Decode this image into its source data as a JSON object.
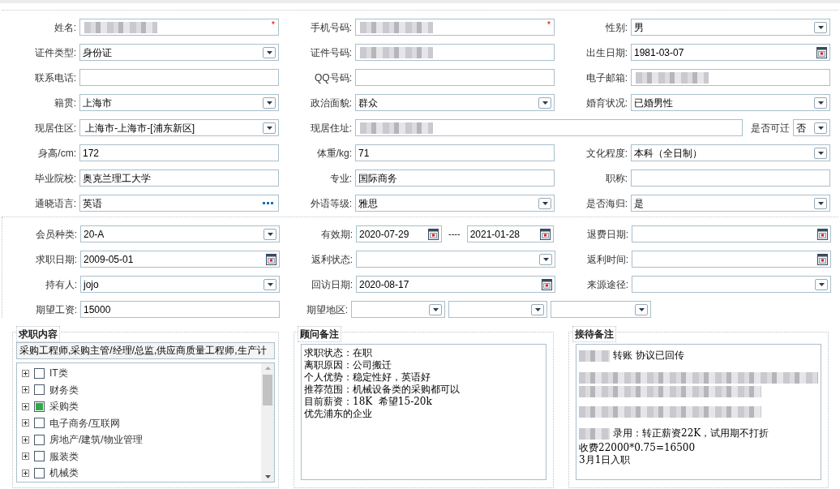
{
  "sections": [
    {
      "rows": [
        {
          "cells": [
            {
              "label": "姓名:",
              "kind": "text",
              "redacted": true,
              "required_mark": "*"
            },
            {
              "label": "手机号码:",
              "kind": "text",
              "redacted": true,
              "required_mark": "*"
            },
            {
              "label": "性别:",
              "kind": "select",
              "value": "男"
            }
          ]
        },
        {
          "cells": [
            {
              "label": "证件类型:",
              "kind": "select",
              "value": "身份证"
            },
            {
              "label": "证件号码:",
              "kind": "text",
              "redacted": true
            },
            {
              "label": "出生日期:",
              "kind": "date",
              "value": "1981-03-07"
            }
          ]
        },
        {
          "cells": [
            {
              "label": "联系电话:",
              "kind": "text"
            },
            {
              "label": "QQ号码:",
              "kind": "text"
            },
            {
              "label": "电子邮箱:",
              "kind": "text",
              "redacted": true
            }
          ]
        },
        {
          "cells": [
            {
              "label": "籍贯:",
              "kind": "select",
              "value": "上海市"
            },
            {
              "label": "政治面貌:",
              "kind": "select",
              "value": "群众"
            },
            {
              "label": "婚育状况:",
              "kind": "select",
              "value": "已婚男性"
            }
          ]
        },
        {
          "cells": [
            {
              "label": "现居住区:",
              "kind": "select",
              "value": " 上海市-上海市-[浦东新区]"
            },
            {
              "label": "现居住址:",
              "kind": "wide",
              "redacted": true
            },
            {
              "label": "是否可迁",
              "kind": "compact",
              "value": "否"
            }
          ]
        },
        {
          "cells": [
            {
              "label": "身高/cm:",
              "kind": "text",
              "value": "172"
            },
            {
              "label": "体重/kg:",
              "kind": "text",
              "value": "71"
            },
            {
              "label": "文化程度:",
              "kind": "select",
              "value": "本科（全日制）"
            }
          ]
        },
        {
          "cells": [
            {
              "label": "毕业院校:",
              "kind": "text",
              "value": "奥克兰理工大学"
            },
            {
              "label": "专业:",
              "kind": "text",
              "value": "国际商务"
            },
            {
              "label": "职称:",
              "kind": "text"
            }
          ]
        },
        {
          "cells": [
            {
              "label": "通晓语言:",
              "kind": "lookup",
              "value": "英语"
            },
            {
              "label": "外语等级:",
              "kind": "select",
              "value": "雅思"
            },
            {
              "label": "是否海归:",
              "kind": "select",
              "value": "是"
            }
          ]
        }
      ]
    },
    {
      "rows": [
        {
          "cells": [
            {
              "label": "会员种类:",
              "kind": "select",
              "value": "20-A"
            },
            {
              "label": "有效期:",
              "kind": "daterange",
              "from": "2020-07-29",
              "separator": "----",
              "to": "2021-01-28"
            },
            {
              "label": "退费日期:",
              "kind": "date"
            }
          ]
        },
        {
          "cells": [
            {
              "label": "求职日期:",
              "kind": "date",
              "value": "2009-05-01"
            },
            {
              "label": "返利状态:",
              "kind": "select"
            },
            {
              "label": "返利时间:",
              "kind": "date"
            }
          ]
        },
        {
          "cells": [
            {
              "label": "持有人:",
              "kind": "select",
              "value": "jojo"
            },
            {
              "label": "回访日期:",
              "kind": "date",
              "value": "2020-08-17"
            },
            {
              "label": "来源途径:",
              "kind": "select"
            }
          ]
        },
        {
          "cells": [
            {
              "label": "期望工资:",
              "kind": "text",
              "value": "15000"
            },
            {
              "label": "期望地区:",
              "kind": "multiselect",
              "selects": [
                {
                  "kind": "select"
                },
                {
                  "kind": "select"
                },
                {
                  "kind": "select"
                }
              ]
            }
          ]
        }
      ]
    }
  ],
  "panels": [
    {
      "kind": "tree",
      "legend": "求职内容",
      "summary": "采购工程师,采购主管/经理/总监,供应商质量工程师,生产计",
      "items": [
        {
          "label": "IT类",
          "checked": false
        },
        {
          "label": "财务类",
          "checked": false
        },
        {
          "label": "采购类",
          "checked": true
        },
        {
          "label": "电子商务/互联网",
          "checked": false
        },
        {
          "label": "房地产/建筑/物业管理",
          "checked": false
        },
        {
          "label": "服装类",
          "checked": false
        },
        {
          "label": "机械类",
          "checked": false
        }
      ]
    },
    {
      "kind": "notes",
      "legend": "顾问备注",
      "lines": [
        {
          "kind": "text",
          "text": "求职状态：在职"
        },
        {
          "kind": "text",
          "text": "离职原因：公司搬迁"
        },
        {
          "kind": "text",
          "text": "个人优势：稳定性好，英语好"
        },
        {
          "kind": "text",
          "text": "推荐范围：机械设备类的采购都可以"
        },
        {
          "kind": "text",
          "text": "目前薪资：18K  希望15-20k"
        },
        {
          "kind": "text",
          "text": "优先浦东的企业"
        }
      ]
    },
    {
      "kind": "notes",
      "legend": "接待备注",
      "lines": [
        {
          "kind": "prefixed",
          "text": "转账 协议已回传"
        },
        {
          "kind": "blank"
        },
        {
          "kind": "blurred-long"
        },
        {
          "kind": "blurred-short"
        },
        {
          "kind": "blank"
        },
        {
          "kind": "blurred-short"
        },
        {
          "kind": "blank"
        },
        {
          "kind": "prefixed",
          "text": "录用：转正薪资22K，试用期不打折"
        },
        {
          "kind": "text",
          "text": "收费22000*0.75=16500"
        },
        {
          "kind": "text",
          "text": "3月1日入职"
        }
      ]
    }
  ]
}
